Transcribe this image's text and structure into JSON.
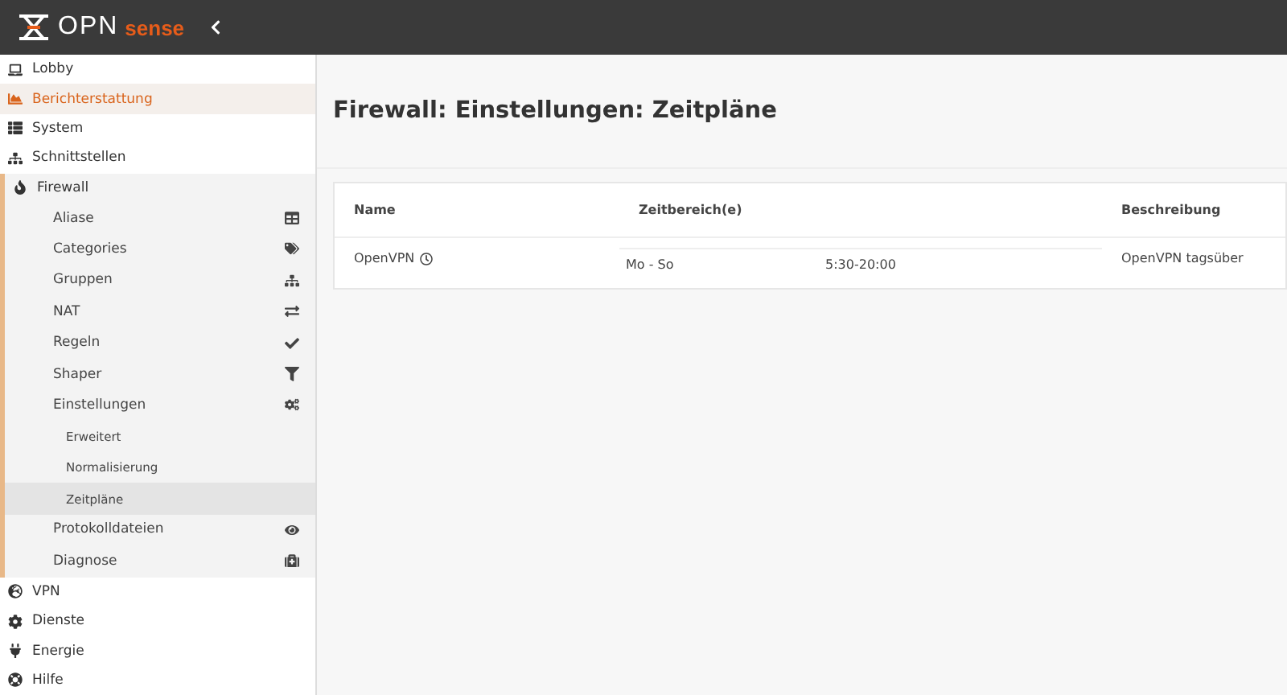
{
  "brand": {
    "logo_left": "OPN",
    "logo_right": "sense"
  },
  "sidebar": {
    "items": [
      {
        "label": "Lobby",
        "hovered": false,
        "expanded": false
      },
      {
        "label": "Berichterstattung",
        "hovered": true,
        "expanded": false
      },
      {
        "label": "System",
        "hovered": false,
        "expanded": false
      },
      {
        "label": "Schnittstellen",
        "hovered": false,
        "expanded": false
      },
      {
        "label": "Firewall",
        "hovered": false,
        "expanded": true,
        "children": [
          {
            "label": "Aliase",
            "selected": false
          },
          {
            "label": "Categories",
            "selected": false
          },
          {
            "label": "Gruppen",
            "selected": false
          },
          {
            "label": "NAT",
            "selected": false
          },
          {
            "label": "Regeln",
            "selected": false
          },
          {
            "label": "Shaper",
            "selected": false
          },
          {
            "label": "Einstellungen",
            "expanded": true,
            "selected": false,
            "children": [
              {
                "label": "Erweitert",
                "selected": false
              },
              {
                "label": "Normalisierung",
                "selected": false
              },
              {
                "label": "Zeitpläne",
                "selected": true
              }
            ]
          },
          {
            "label": "Protokolldateien",
            "selected": false
          },
          {
            "label": "Diagnose",
            "selected": false
          }
        ]
      },
      {
        "label": "VPN",
        "hovered": false,
        "expanded": false
      },
      {
        "label": "Dienste",
        "hovered": false,
        "expanded": false
      },
      {
        "label": "Energie",
        "hovered": false,
        "expanded": false
      },
      {
        "label": "Hilfe",
        "hovered": false,
        "expanded": false
      }
    ]
  },
  "page": {
    "title": "Firewall: Einstellungen: Zeitpläne"
  },
  "table": {
    "columns": [
      "Name",
      "Zeitbereich(e)",
      "Beschreibung"
    ],
    "rows": [
      {
        "name": "OpenVPN",
        "days": "Mo - So",
        "time": "5:30-20:00",
        "description": "OpenVPN tagsüber"
      }
    ]
  }
}
